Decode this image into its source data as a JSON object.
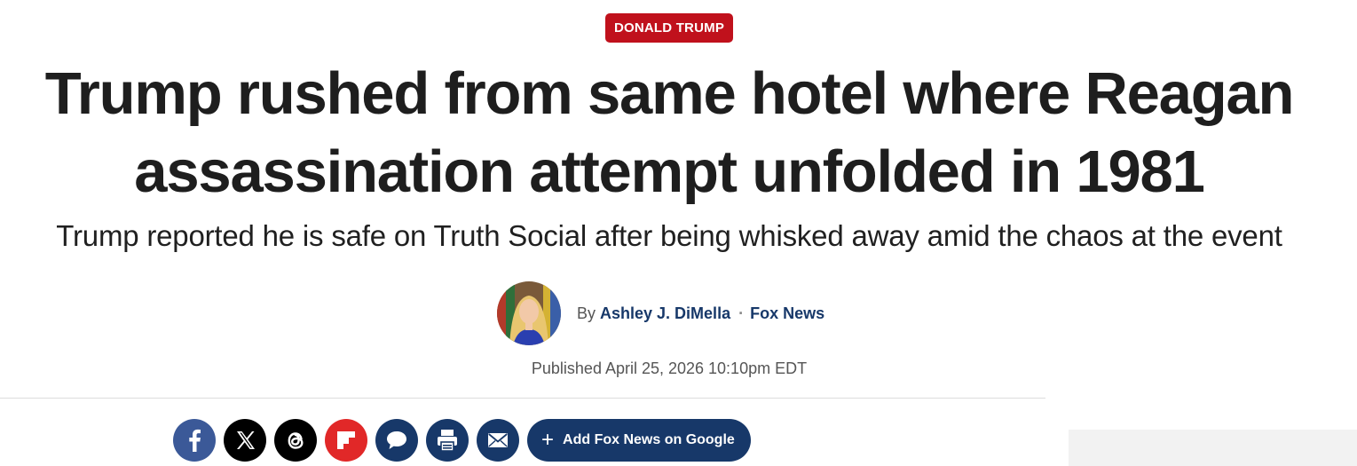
{
  "category": {
    "label": "DONALD TRUMP",
    "color": "#c0111c"
  },
  "article": {
    "headline_line1": "Trump rushed from same hotel where Reagan",
    "headline_line2": "assassination attempt unfolded in 1981",
    "subheadline": "Trump reported he is safe on Truth Social after being whisked away amid the chaos at the event"
  },
  "byline": {
    "prefix": "By",
    "author": "Ashley J. DiMella",
    "separator": "·",
    "outlet": "Fox News",
    "avatar": "author-photo"
  },
  "published": "Published April 25, 2026 10:10pm EDT",
  "share": {
    "buttons": [
      {
        "name": "facebook",
        "icon": "facebook-icon",
        "color": "#3b5998"
      },
      {
        "name": "x",
        "icon": "x-icon",
        "color": "#000000"
      },
      {
        "name": "threads",
        "icon": "threads-icon",
        "color": "#000000"
      },
      {
        "name": "flipboard",
        "icon": "flipboard-icon",
        "color": "#e12828"
      },
      {
        "name": "comments",
        "icon": "comment-icon",
        "color": "#173869"
      },
      {
        "name": "print",
        "icon": "print-icon",
        "color": "#173869"
      },
      {
        "name": "email",
        "icon": "email-icon",
        "color": "#173869"
      }
    ],
    "google_label": "Add Fox News on Google",
    "google_icon": "plus-icon",
    "brand_color": "#173869"
  }
}
